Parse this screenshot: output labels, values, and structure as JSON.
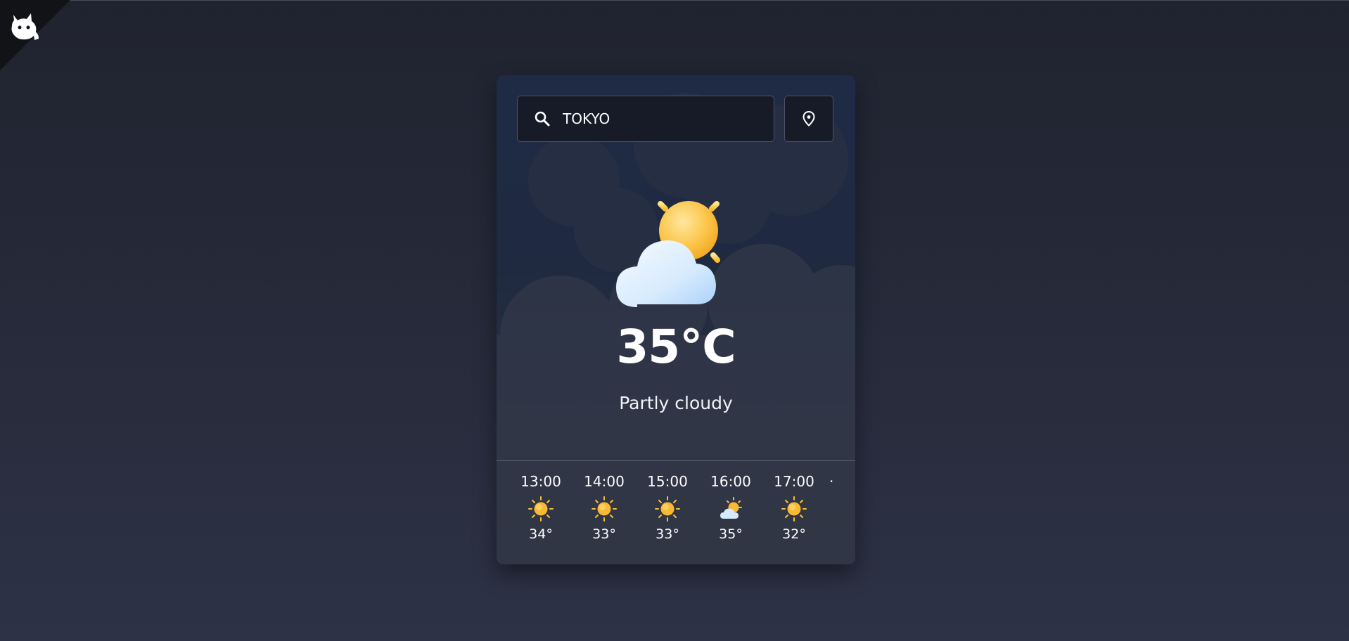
{
  "search": {
    "value": "TOKYO",
    "icon": "search-icon"
  },
  "location_button": {
    "icon": "location-pin-icon"
  },
  "current": {
    "icon": "partly-cloudy-icon",
    "temperature": "35°C",
    "condition": "Partly cloudy"
  },
  "hourly": [
    {
      "time": "13:00",
      "icon": "sunny-icon",
      "temp": "34°"
    },
    {
      "time": "14:00",
      "icon": "sunny-icon",
      "temp": "33°"
    },
    {
      "time": "15:00",
      "icon": "sunny-icon",
      "temp": "33°"
    },
    {
      "time": "16:00",
      "icon": "partly-cloudy-icon",
      "temp": "35°"
    },
    {
      "time": "17:00",
      "icon": "sunny-icon",
      "temp": "32°"
    }
  ],
  "colors": {
    "background": "#252938",
    "card": "#1f2a41",
    "sun": "#f7b72d",
    "cloud": "#dcefff",
    "text": "#ffffff"
  }
}
